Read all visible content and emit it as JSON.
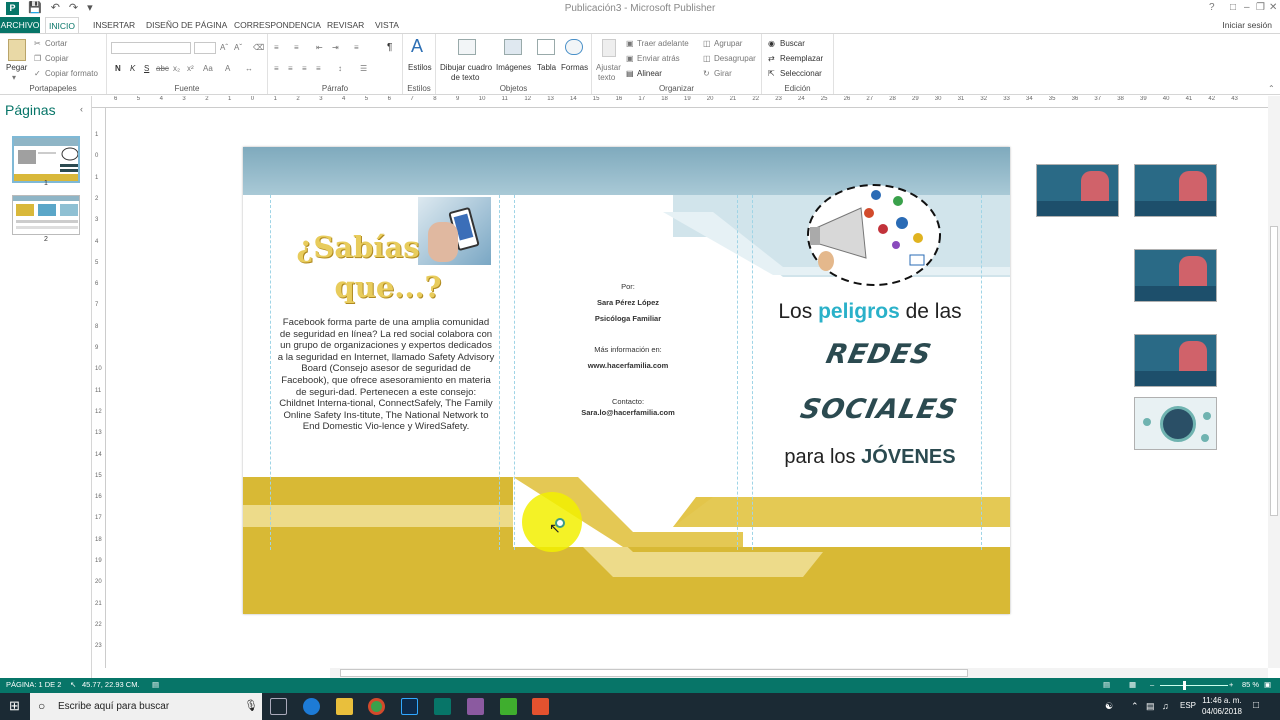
{
  "window": {
    "title": "Publicación3 - Microsoft Publisher",
    "signin": "Iniciar sesión",
    "help": "?"
  },
  "tabs": [
    "ARCHIVO",
    "INICIO",
    "INSERTAR",
    "DISEÑO DE PÁGINA",
    "CORRESPONDENCIA",
    "REVISAR",
    "VISTA"
  ],
  "ribbon": {
    "clipboard": {
      "paste": "Pegar",
      "cut": "Cortar",
      "copy": "Copiar",
      "format": "Copiar formato",
      "label": "Portapapeles"
    },
    "font": {
      "label": "Fuente",
      "bold": "N",
      "italic": "K",
      "underline": "S",
      "strike": "abc"
    },
    "paragraph": {
      "label": "Párrafo",
      "pilcrow": "¶"
    },
    "styles": {
      "label": "Estilos",
      "btn": "Estilos"
    },
    "objects": {
      "label": "Objetos",
      "textbox": "Dibujar cuadro",
      "textbox2": "de texto",
      "images": "Imágenes",
      "table": "Tabla",
      "shapes": "Formas"
    },
    "arrange": {
      "label": "Organizar",
      "wrap": "Ajustar",
      "wrap2": "texto",
      "front": "Traer adelante",
      "back": "Enviar atrás",
      "align": "Alinear",
      "group": "Agrupar",
      "ungroup": "Desagrupar",
      "rotate": "Girar"
    },
    "edit": {
      "label": "Edición",
      "find": "Buscar",
      "replace": "Reemplazar",
      "select": "Seleccionar"
    }
  },
  "pages_pane": {
    "title": "Páginas",
    "pages": [
      "1",
      "2"
    ]
  },
  "hruler": [
    "6",
    "5",
    "4",
    "3",
    "2",
    "1",
    "0",
    "1",
    "2",
    "3",
    "4",
    "5",
    "6",
    "7",
    "8",
    "9",
    "10",
    "11",
    "12",
    "13",
    "14",
    "15",
    "16",
    "17",
    "18",
    "19",
    "20",
    "21",
    "22",
    "23",
    "24",
    "25",
    "26",
    "27",
    "28",
    "29",
    "30",
    "31",
    "32",
    "33",
    "34",
    "35",
    "36",
    "37",
    "38",
    "39",
    "40",
    "41",
    "42",
    "43"
  ],
  "vruler": [
    "1",
    "0",
    "1",
    "2",
    "3",
    "4",
    "5",
    "6",
    "7",
    "8",
    "9",
    "10",
    "11",
    "12",
    "13",
    "14",
    "15",
    "16",
    "17",
    "18",
    "19",
    "20",
    "21",
    "22",
    "23"
  ],
  "publication": {
    "heading1": "¿Sabías",
    "heading2": "que...?",
    "body": "Facebook forma parte de una amplia comunidad de seguridad en línea? La red social colabora con un grupo de organizaciones y expertos dedicados a la seguridad en Internet, llamado Safety Advisory Board (Consejo asesor de seguridad de Facebook), que ofrece asesoramiento en materia de seguri-dad. Pertenecen a este consejo: Childnet Interna-tional, ConnectSafely, The Family Online Safety Ins-titute, The National Network to End Domestic Vio-lence y WiredSafety.",
    "por": "Por:",
    "author": "Sara Pérez López",
    "role": "Psicóloga Familiar",
    "more_info": "Más información en:",
    "website": "www.hacerfamilia.com",
    "contact_label": "Contacto:",
    "email": "Sara.lo@hacerfamilia.com",
    "title_pre": "Los",
    "title_em": "peligros",
    "title_post": "de las",
    "title_redes": "REDES",
    "title_sociales": "SOCIALES",
    "title_para": "para los",
    "title_jovenes": "JÓVENES"
  },
  "statusbar": {
    "page": "PÁGINA: 1 DE 2",
    "coords": "45.77, 22.93 CM.",
    "zoom": "85 %"
  },
  "taskbar": {
    "search": "Escribe aquí para buscar",
    "time": "11:46 a. m.",
    "date": "04/06/2018",
    "lang": "ESP"
  },
  "colors": {
    "accent": "#077568",
    "gold": "#d9b83a",
    "teal_text": "#2ab1c9"
  }
}
